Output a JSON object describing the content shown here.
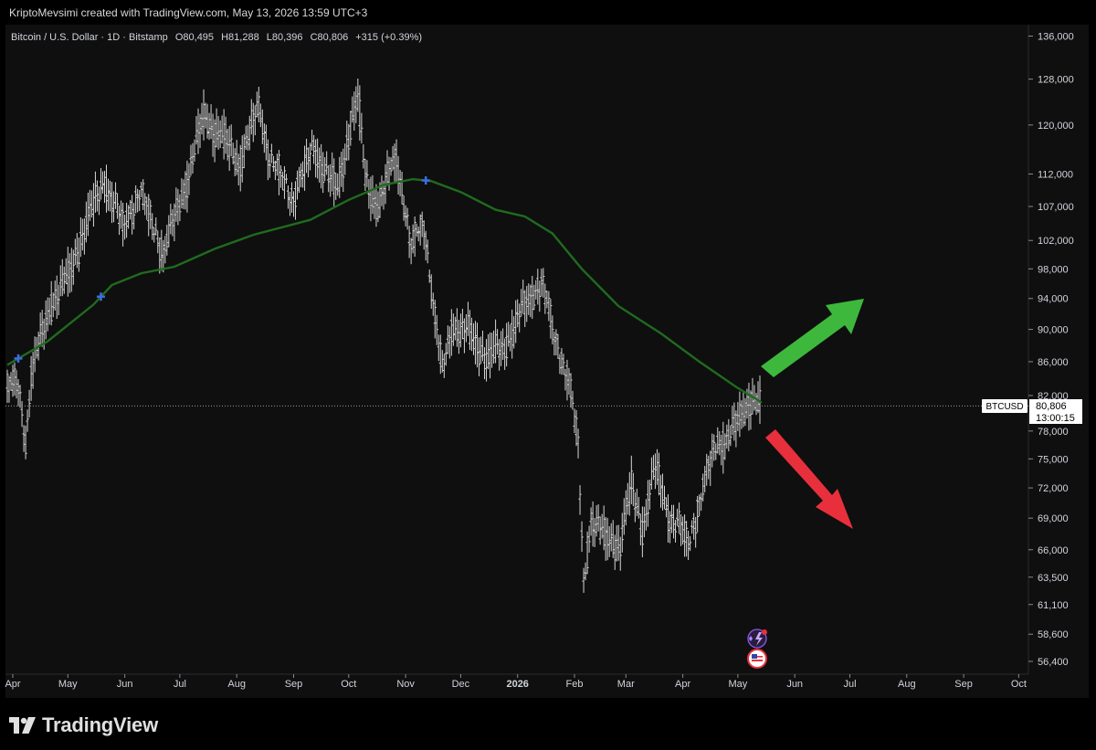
{
  "header": {
    "credit": "KriptoMevsimi created with TradingView.com, May 13, 2026 13:59 UTC+3"
  },
  "legend": {
    "symbol": "Bitcoin / U.S. Dollar · 1D · Bitstamp",
    "open": "O80,495",
    "high": "H81,288",
    "low": "L80,396",
    "close": "C80,806",
    "change": "+315 (+0.39%)"
  },
  "price_label": {
    "ticker": "BTCUSD",
    "price": "80,806",
    "countdown": "13:00:15"
  },
  "brand": {
    "name": "TradingView"
  },
  "colors": {
    "background": "#0f0f0f",
    "candles": "#d6d6d6",
    "moving_average": "#1f6b1f",
    "marker": "#3b6de0",
    "arrow_up": "#3db83d",
    "arrow_down": "#e8303c"
  },
  "chart_data": {
    "type": "ohlc-bar",
    "log_scale": true,
    "grid": false,
    "y_ticks": [
      136000,
      128000,
      120000,
      112000,
      107000,
      102000,
      98000,
      94000,
      90000,
      86000,
      82000,
      78000,
      75000,
      72000,
      69000,
      66000,
      63500,
      61100,
      58600,
      56400
    ],
    "y_tick_labels": [
      "136,000",
      "128,000",
      "120,000",
      "112,000",
      "107,000",
      "102,000",
      "98,000",
      "94,000",
      "90,000",
      "86,000",
      "82,000",
      "78,000",
      "75,000",
      "72,000",
      "69,000",
      "66,000",
      "63,500",
      "61,100",
      "58,600",
      "56,400"
    ],
    "x_ticks": [
      {
        "label": "Apr",
        "date": "2025-04-01"
      },
      {
        "label": "May",
        "date": "2025-05-01"
      },
      {
        "label": "Jun",
        "date": "2025-06-01"
      },
      {
        "label": "Jul",
        "date": "2025-07-01"
      },
      {
        "label": "Aug",
        "date": "2025-08-01"
      },
      {
        "label": "Sep",
        "date": "2025-09-01"
      },
      {
        "label": "Oct",
        "date": "2025-10-01"
      },
      {
        "label": "Nov",
        "date": "2025-11-01"
      },
      {
        "label": "Dec",
        "date": "2025-12-01"
      },
      {
        "label": "2026",
        "date": "2026-01-01",
        "bold": true
      },
      {
        "label": "Feb",
        "date": "2026-02-01"
      },
      {
        "label": "Mar",
        "date": "2026-03-01"
      },
      {
        "label": "Apr",
        "date": "2026-04-01"
      },
      {
        "label": "May",
        "date": "2026-05-01"
      },
      {
        "label": "Jun",
        "date": "2026-06-01"
      },
      {
        "label": "Jul",
        "date": "2026-07-01"
      },
      {
        "label": "Aug",
        "date": "2026-08-01"
      },
      {
        "label": "Sep",
        "date": "2026-09-01"
      },
      {
        "label": "Oct",
        "date": "2026-10-01"
      }
    ],
    "price_anchors": [
      [
        "2025-03-29",
        83000
      ],
      [
        "2025-04-04",
        83500
      ],
      [
        "2025-04-08",
        76800
      ],
      [
        "2025-04-11",
        84500
      ],
      [
        "2025-04-22",
        93500
      ],
      [
        "2025-05-02",
        97000
      ],
      [
        "2025-05-09",
        103000
      ],
      [
        "2025-05-21",
        111000
      ],
      [
        "2025-05-31",
        104000
      ],
      [
        "2025-06-09",
        109500
      ],
      [
        "2025-06-22",
        100500
      ],
      [
        "2025-07-03",
        109000
      ],
      [
        "2025-07-11",
        118000
      ],
      [
        "2025-07-14",
        121000
      ],
      [
        "2025-07-24",
        118000
      ],
      [
        "2025-08-02",
        113500
      ],
      [
        "2025-08-13",
        123000
      ],
      [
        "2025-08-19",
        115000
      ],
      [
        "2025-08-31",
        108500
      ],
      [
        "2025-09-12",
        116000
      ],
      [
        "2025-09-25",
        109000
      ],
      [
        "2025-10-02",
        120000
      ],
      [
        "2025-10-06",
        124500
      ],
      [
        "2025-10-10",
        111000
      ],
      [
        "2025-10-17",
        107000
      ],
      [
        "2025-10-27",
        115000
      ],
      [
        "2025-11-04",
        101000
      ],
      [
        "2025-11-11",
        105000
      ],
      [
        "2025-11-16",
        93500
      ],
      [
        "2025-11-21",
        84500
      ],
      [
        "2025-11-26",
        90500
      ],
      [
        "2025-12-05",
        89500
      ],
      [
        "2025-12-15",
        86500
      ],
      [
        "2025-12-24",
        87500
      ],
      [
        "2026-01-05",
        93000
      ],
      [
        "2026-01-14",
        96500
      ],
      [
        "2026-01-20",
        90000
      ],
      [
        "2026-01-29",
        84000
      ],
      [
        "2026-02-03",
        76000
      ],
      [
        "2026-02-06",
        63000
      ],
      [
        "2026-02-10",
        69000
      ],
      [
        "2026-02-18",
        67000
      ],
      [
        "2026-02-26",
        66500
      ],
      [
        "2026-03-04",
        72000
      ],
      [
        "2026-03-10",
        68000
      ],
      [
        "2026-03-17",
        74000
      ],
      [
        "2026-03-24",
        69500
      ],
      [
        "2026-03-31",
        68000
      ],
      [
        "2026-04-04",
        66500
      ],
      [
        "2026-04-11",
        71500
      ],
      [
        "2026-04-19",
        76500
      ],
      [
        "2026-04-26",
        77500
      ],
      [
        "2026-05-03",
        79500
      ],
      [
        "2026-05-08",
        81800
      ],
      [
        "2026-05-13",
        80806
      ]
    ],
    "moving_average": [
      [
        "2025-03-29",
        85600
      ],
      [
        "2025-04-20",
        88500
      ],
      [
        "2025-05-15",
        93200
      ],
      [
        "2025-05-25",
        95800
      ],
      [
        "2025-06-10",
        97400
      ],
      [
        "2025-06-28",
        98300
      ],
      [
        "2025-07-20",
        100800
      ],
      [
        "2025-08-10",
        102800
      ],
      [
        "2025-09-10",
        105000
      ],
      [
        "2025-10-01",
        108000
      ],
      [
        "2025-10-20",
        110300
      ],
      [
        "2025-11-05",
        111200
      ],
      [
        "2025-11-15",
        110900
      ],
      [
        "2025-12-01",
        109200
      ],
      [
        "2025-12-20",
        106500
      ],
      [
        "2026-01-05",
        105500
      ],
      [
        "2026-01-20",
        103000
      ],
      [
        "2026-02-05",
        98000
      ],
      [
        "2026-02-25",
        93000
      ],
      [
        "2026-03-20",
        89500
      ],
      [
        "2026-04-10",
        86000
      ],
      [
        "2026-04-30",
        83000
      ],
      [
        "2026-05-14",
        81200
      ]
    ],
    "markers": [
      "2025-04-04",
      "2025-05-19",
      "2025-11-12"
    ],
    "last_price": 80806,
    "annotations": [
      {
        "type": "arrow",
        "direction": "up",
        "color": "#3db83d"
      },
      {
        "type": "arrow",
        "direction": "down",
        "color": "#e8303c"
      }
    ]
  }
}
